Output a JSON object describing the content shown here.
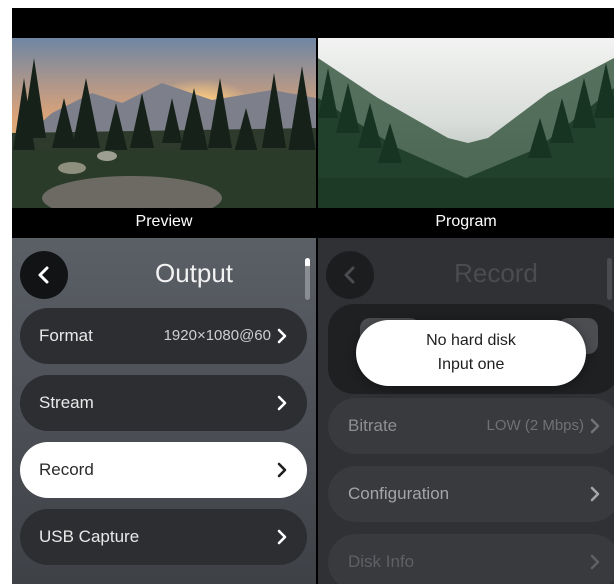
{
  "panes": {
    "preview_label": "Preview",
    "program_label": "Program"
  },
  "output_menu": {
    "title": "Output",
    "items": [
      {
        "label": "Format",
        "value": "1920×1080@60"
      },
      {
        "label": "Stream",
        "value": ""
      },
      {
        "label": "Record",
        "value": ""
      },
      {
        "label": "USB Capture",
        "value": ""
      }
    ],
    "selected_item": "Record"
  },
  "record_menu": {
    "title": "Record",
    "items": [
      {
        "label": "Bitrate",
        "value": "LOW (2 Mbps)"
      },
      {
        "label": "Configuration",
        "value": ""
      },
      {
        "label": "Disk Info",
        "value": ""
      }
    ]
  },
  "toast": {
    "line1": "No hard disk",
    "line2": "Input one"
  },
  "colors": {
    "menu_bg_top": "#5b5f66",
    "item_bg": "#2c2e32",
    "active_item_bg": "#ffffff",
    "toast_bg": "#ffffff"
  },
  "icons": [
    "chevron-left-icon",
    "chevron-right-icon"
  ]
}
